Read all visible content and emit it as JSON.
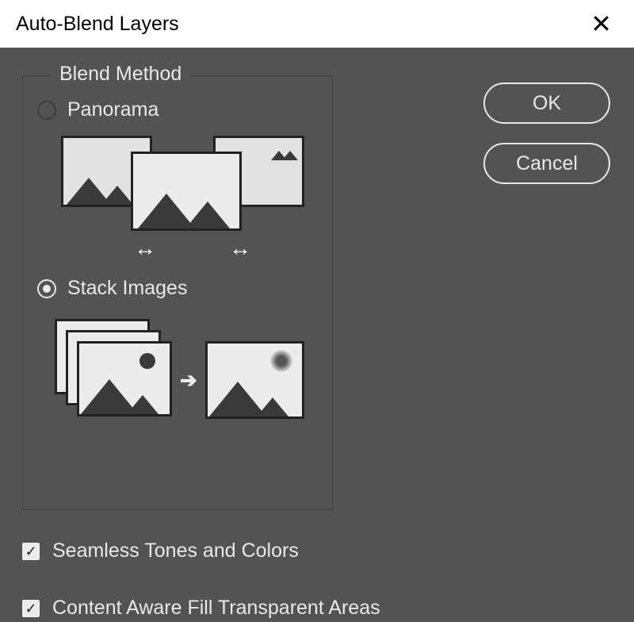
{
  "dialog": {
    "title": "Auto-Blend Layers"
  },
  "blendMethod": {
    "legend": "Blend Method",
    "panorama": {
      "label": "Panorama",
      "selected": false
    },
    "stack": {
      "label": "Stack Images",
      "selected": true
    }
  },
  "buttons": {
    "ok": "OK",
    "cancel": "Cancel"
  },
  "checkboxes": {
    "seamless": {
      "label": "Seamless Tones and Colors",
      "checked": true
    },
    "contentAwareFill": {
      "label": "Content Aware Fill Transparent Areas",
      "checked": true
    }
  },
  "glyphs": {
    "check": "✓",
    "hArrow": "↔",
    "rArrow": "➔"
  }
}
